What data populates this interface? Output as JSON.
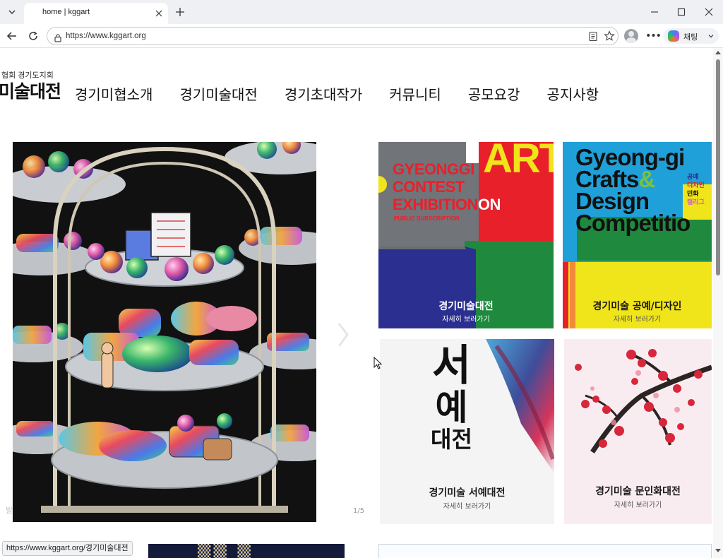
{
  "browser": {
    "tab_title": "home | kggart",
    "url": "https://www.kggart.org",
    "copilot_label": "채팅",
    "status_url": "https://www.kggart.org/경기미술대전"
  },
  "site": {
    "logo_sub": "협회 경기도지회",
    "logo_main": "미술대전",
    "nav": [
      "경기미협소개",
      "경기미술대전",
      "경기초대작가",
      "커뮤니티",
      "공모요강",
      "공지사항"
    ]
  },
  "slider": {
    "indicator": "1/5",
    "ghost_text": "발"
  },
  "cards": [
    {
      "title": "경기미술대전",
      "link": "자세히 보러가기",
      "art_lines": [
        "GYEONGGI",
        "CONTEST",
        "EXHIBITION"
      ],
      "art_suffix": "ON",
      "art_big": "ART",
      "art_small": "PUBLIC SUBSCRIPTION"
    },
    {
      "title": "경기미술 공예/디자인",
      "link": "자세히 보러가기",
      "art_lines": [
        "Gyeong-gi",
        "Crafts",
        "Design",
        "Competitio"
      ],
      "art_amp": "&",
      "art_side": [
        "공예",
        "디자인",
        "민화",
        "캘리그"
      ]
    },
    {
      "title": "경기미술 서예대전",
      "link": "자세히 보러가기",
      "art_lines": [
        "서",
        "예",
        "대전"
      ]
    },
    {
      "title": "경기미술 문인화대전",
      "link": "자세히 보러가기"
    }
  ],
  "colors": {
    "red": "#e8202a",
    "navy": "#2b2f8f",
    "green": "#1f8a3e",
    "cyan": "#1fa0d8",
    "yellow": "#f0e41a"
  }
}
